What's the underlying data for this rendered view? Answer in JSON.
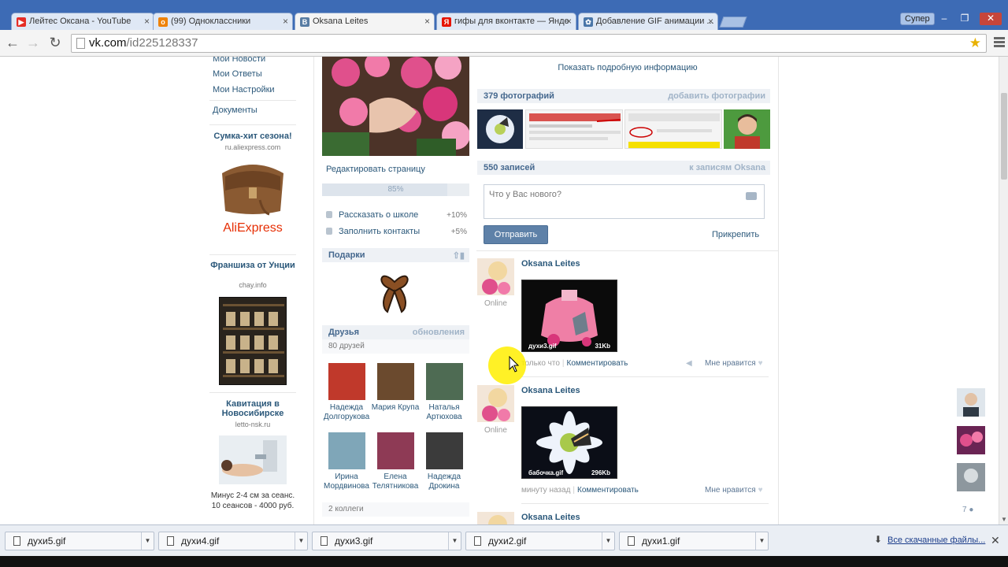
{
  "browser": {
    "tabs": [
      {
        "title": "Лейтес Оксана - YouTube",
        "favicon": "youtube-icon",
        "color": "#e52d27"
      },
      {
        "title": "(99) Одноклассники",
        "favicon": "odnoklassniki-icon",
        "color": "#ee8208"
      },
      {
        "title": "Oksana Leites",
        "favicon": "vk-icon",
        "color": "#597da3"
      },
      {
        "title": "гифы для вконтакте — Янде",
        "favicon": "yandex-icon",
        "color": "#e61400"
      },
      {
        "title": "Добавление GIF анимации ...",
        "favicon": "gear-icon",
        "color": "#4a76a8"
      }
    ],
    "profile_label": "Супер",
    "url_host": "vk.com",
    "url_path": "/id225128337"
  },
  "sidebar": {
    "links": [
      "Мои Новости",
      "Мои Ответы",
      "Мои Настройки",
      "Документы"
    ],
    "ads": [
      {
        "title": "Сумка-хит сезона!",
        "domain": "ru.aliexpress.com",
        "brand": "AliExpress"
      },
      {
        "title": "Франшиза от Унции",
        "domain": "chay.info"
      },
      {
        "title": "Кавитация в Новосибирске",
        "domain": "letto-nsk.ru",
        "text": "Минус 2-4 см за сеанс. 10 сеансов - 4000 руб."
      }
    ]
  },
  "profile": {
    "edit_label": "Редактировать страницу",
    "progress_label": "85%",
    "progress_value": 0.85,
    "tasks": [
      {
        "label": "Рассказать о школе",
        "pct": "+10%"
      },
      {
        "label": "Заполнить контакты",
        "pct": "+5%"
      }
    ],
    "gifts_title": "Подарки",
    "friends": {
      "title": "Друзья",
      "updates_label": "обновления",
      "count_label": "80 друзей",
      "items": [
        {
          "name": "Надежда Долгорукова",
          "color": "#c0392b"
        },
        {
          "name": "Мария Крупа",
          "color": "#6b4a2e"
        },
        {
          "name": "Наталья Артюхова",
          "color": "#4e6b53"
        },
        {
          "name": "Ирина Мордвинова",
          "color": "#7fa6b8"
        },
        {
          "name": "Елена Телятникова",
          "color": "#8e3a55"
        },
        {
          "name": "Надежда Дрокина",
          "color": "#3b3b3b"
        }
      ],
      "colleagues_label": "2 коллеги"
    }
  },
  "main": {
    "show_info_label": "Показать подробную информацию",
    "photos": {
      "title": "379 фотографий",
      "add_label": "добавить фотографии"
    },
    "posts_header": {
      "title": "550 записей",
      "to_posts_label": "к записям Oksana"
    },
    "composer": {
      "placeholder": "Что у Вас нового?",
      "send_label": "Отправить",
      "attach_label": "Прикрепить"
    },
    "posts": [
      {
        "author": "Oksana Leites",
        "online": "Online",
        "image_caption": "духи3.gif",
        "image_size": "31Kb",
        "time": "только что",
        "comment_label": "Комментировать",
        "like_label": "Мне нравится"
      },
      {
        "author": "Oksana Leites",
        "online": "Online",
        "image_caption": "бабочка.gif",
        "image_size": "296Kb",
        "time": "минуту назад",
        "comment_label": "Комментировать",
        "like_label": "Мне нравится"
      },
      {
        "author": "Oksana Leites"
      }
    ]
  },
  "right_rail": {
    "count_label": "7"
  },
  "downloads": {
    "items": [
      "духи5.gif",
      "духи4.gif",
      "духи3.gif",
      "духи2.gif",
      "духи1.gif"
    ],
    "show_all_label": "Все скачанные файлы..."
  }
}
